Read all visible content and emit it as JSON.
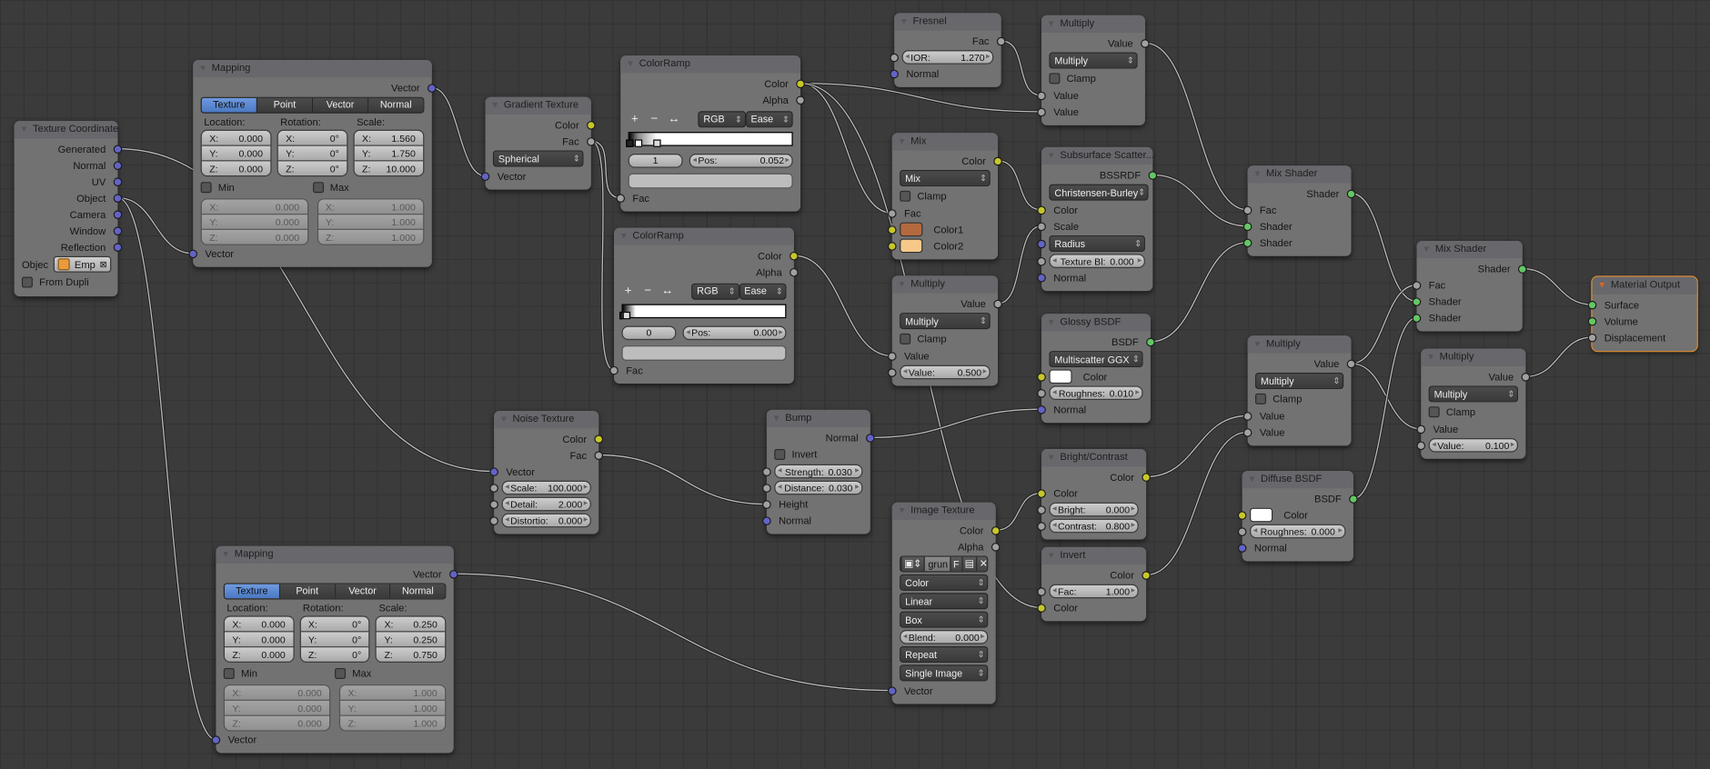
{
  "socket_colors": {
    "shader": "#63c763",
    "color": "#c7c729",
    "value": "#a1a1a1",
    "vector": "#6363c7"
  },
  "active_outline_color": "#e8912e",
  "nodes": [
    {
      "id": "texcoord",
      "title": "Texture Coordinate",
      "rows": [
        {
          "t": "out",
          "label": "Generated",
          "s": "vector"
        },
        {
          "t": "out",
          "label": "Normal",
          "s": "vector"
        },
        {
          "t": "out",
          "label": "UV",
          "s": "vector"
        },
        {
          "t": "out",
          "label": "Object",
          "s": "vector"
        },
        {
          "t": "out",
          "label": "Camera",
          "s": "vector"
        },
        {
          "t": "out",
          "label": "Window",
          "s": "vector"
        },
        {
          "t": "out",
          "label": "Reflection",
          "s": "vector"
        },
        {
          "t": "obj",
          "label": "Objec",
          "value": "Emp",
          "icon": "cube-icon"
        },
        {
          "t": "check",
          "label": "From Dupli"
        }
      ]
    },
    {
      "id": "mapping1",
      "title": "Mapping",
      "rows": [
        {
          "t": "out",
          "label": "Vector",
          "s": "vector"
        },
        {
          "t": "tabs",
          "items": [
            "Texture",
            "Point",
            "Vector",
            "Normal"
          ],
          "active": 0
        },
        {
          "t": "mapgrid",
          "labels": [
            "Location:",
            "Rotation:",
            "Scale:"
          ],
          "cols": [
            [
              [
                "X:",
                "0.000"
              ],
              [
                "Y:",
                "0.000"
              ],
              [
                "Z:",
                "0.000"
              ]
            ],
            [
              [
                "X:",
                "0°"
              ],
              [
                "Y:",
                "0°"
              ],
              [
                "Z:",
                "0°"
              ]
            ],
            [
              [
                "X:",
                "1.560"
              ],
              [
                "Y:",
                "1.750"
              ],
              [
                "Z:",
                "10.000"
              ]
            ]
          ]
        },
        {
          "t": "minmax",
          "min_label": "Min",
          "max_label": "Max",
          "min": [
            [
              "X:",
              "0.000"
            ],
            [
              "Y:",
              "0.000"
            ],
            [
              "Z:",
              "0.000"
            ]
          ],
          "max": [
            [
              "X:",
              "1.000"
            ],
            [
              "Y:",
              "1.000"
            ],
            [
              "Z:",
              "1.000"
            ]
          ]
        },
        {
          "t": "in",
          "label": "Vector",
          "s": "vector"
        }
      ]
    },
    {
      "id": "gradient",
      "title": "Gradient Texture",
      "rows": [
        {
          "t": "out",
          "label": "Color",
          "s": "color"
        },
        {
          "t": "out",
          "label": "Fac",
          "s": "value"
        },
        {
          "t": "select",
          "value": "Spherical"
        },
        {
          "t": "in",
          "label": "Vector",
          "s": "vector"
        }
      ]
    },
    {
      "id": "colorramp1",
      "title": "ColorRamp",
      "rows": [
        {
          "t": "out",
          "label": "Color",
          "s": "color"
        },
        {
          "t": "out",
          "label": "Alpha",
          "s": "value"
        },
        {
          "t": "tools",
          "add": "+",
          "remove": "−",
          "flip": "↔",
          "mode": "RGB",
          "interp": "Ease"
        },
        {
          "t": "ramp",
          "stops": [
            0,
            0.052,
            0.17
          ],
          "active": 1
        },
        {
          "t": "rampsel",
          "index": "1",
          "pos_label": "Pos:",
          "pos": "0.052"
        },
        {
          "t": "colorbar",
          "color": "#bdbdbd"
        },
        {
          "t": "in",
          "label": "Fac",
          "s": "value"
        }
      ]
    },
    {
      "id": "colorramp2",
      "title": "ColorRamp",
      "rows": [
        {
          "t": "out",
          "label": "Color",
          "s": "color"
        },
        {
          "t": "out",
          "label": "Alpha",
          "s": "value"
        },
        {
          "t": "tools",
          "add": "+",
          "remove": "−",
          "flip": "↔",
          "mode": "RGB",
          "interp": "Ease"
        },
        {
          "t": "ramp",
          "stops": [
            0,
            0.02
          ],
          "active": 0
        },
        {
          "t": "rampsel",
          "index": "0",
          "pos_label": "Pos:",
          "pos": "0.000"
        },
        {
          "t": "colorbar",
          "color": "#bdbdbd"
        },
        {
          "t": "in",
          "label": "Fac",
          "s": "value"
        }
      ]
    },
    {
      "id": "fresnel",
      "title": "Fresnel",
      "rows": [
        {
          "t": "out",
          "label": "Fac",
          "s": "value"
        },
        {
          "t": "field",
          "label": "IOR:",
          "value": "1.270",
          "s": "value"
        },
        {
          "t": "in",
          "label": "Normal",
          "s": "vector"
        }
      ]
    },
    {
      "id": "multiply1",
      "title": "Multiply",
      "rows": [
        {
          "t": "out",
          "label": "Value",
          "s": "value"
        },
        {
          "t": "select",
          "value": "Multiply"
        },
        {
          "t": "check",
          "label": "Clamp"
        },
        {
          "t": "in",
          "label": "Value",
          "s": "value"
        },
        {
          "t": "in",
          "label": "Value",
          "s": "value"
        }
      ]
    },
    {
      "id": "mix",
      "title": "Mix",
      "rows": [
        {
          "t": "out",
          "label": "Color",
          "s": "color"
        },
        {
          "t": "select",
          "value": "Mix"
        },
        {
          "t": "check",
          "label": "Clamp"
        },
        {
          "t": "in",
          "label": "Fac",
          "s": "value"
        },
        {
          "t": "swatch",
          "label": "Color1",
          "color": "#b5693f",
          "s": "color"
        },
        {
          "t": "swatch",
          "label": "Color2",
          "color": "#f6c98a",
          "s": "color"
        }
      ]
    },
    {
      "id": "sss",
      "title": "Subsurface Scatter...",
      "rows": [
        {
          "t": "out",
          "label": "BSSRDF",
          "s": "shader"
        },
        {
          "t": "select",
          "value": "Christensen-Burley"
        },
        {
          "t": "in",
          "label": "Color",
          "s": "color"
        },
        {
          "t": "in",
          "label": "Scale",
          "s": "value"
        },
        {
          "t": "select",
          "value": "Radius",
          "s": "vector"
        },
        {
          "t": "field",
          "label": "Texture Bl:",
          "value": "0.000",
          "s": "value",
          "center": true
        },
        {
          "t": "in",
          "label": "Normal",
          "s": "vector"
        }
      ]
    },
    {
      "id": "multiply2",
      "title": "Multiply",
      "rows": [
        {
          "t": "out",
          "label": "Value",
          "s": "value"
        },
        {
          "t": "select",
          "value": "Multiply"
        },
        {
          "t": "check",
          "label": "Clamp"
        },
        {
          "t": "in",
          "label": "Value",
          "s": "value"
        },
        {
          "t": "field",
          "label": "Value:",
          "value": "0.500",
          "s": "value"
        }
      ]
    },
    {
      "id": "glossy",
      "title": "Glossy BSDF",
      "rows": [
        {
          "t": "out",
          "label": "BSDF",
          "s": "shader"
        },
        {
          "t": "select",
          "value": "Multiscatter GGX"
        },
        {
          "t": "swatch",
          "label": "Color",
          "color": "#ffffff",
          "s": "color"
        },
        {
          "t": "field",
          "label": "Roughnes:",
          "value": "0.010",
          "s": "value",
          "center": true
        },
        {
          "t": "in",
          "label": "Normal",
          "s": "vector"
        }
      ]
    },
    {
      "id": "mixshader1",
      "title": "Mix Shader",
      "rows": [
        {
          "t": "out",
          "label": "Shader",
          "s": "shader"
        },
        {
          "t": "in",
          "label": "Fac",
          "s": "value"
        },
        {
          "t": "in",
          "label": "Shader",
          "s": "shader"
        },
        {
          "t": "in",
          "label": "Shader",
          "s": "shader"
        }
      ]
    },
    {
      "id": "mixshader2",
      "title": "Mix Shader",
      "rows": [
        {
          "t": "out",
          "label": "Shader",
          "s": "shader"
        },
        {
          "t": "in",
          "label": "Fac",
          "s": "value"
        },
        {
          "t": "in",
          "label": "Shader",
          "s": "shader"
        },
        {
          "t": "in",
          "label": "Shader",
          "s": "shader"
        }
      ]
    },
    {
      "id": "matout",
      "title": "Material Output",
      "active": true,
      "rows": [
        {
          "t": "in",
          "label": "Surface",
          "s": "shader"
        },
        {
          "t": "in",
          "label": "Volume",
          "s": "shader"
        },
        {
          "t": "in",
          "label": "Displacement",
          "s": "value"
        }
      ]
    },
    {
      "id": "multiply3",
      "title": "Multiply",
      "rows": [
        {
          "t": "out",
          "label": "Value",
          "s": "value"
        },
        {
          "t": "select",
          "value": "Multiply"
        },
        {
          "t": "check",
          "label": "Clamp"
        },
        {
          "t": "in",
          "label": "Value",
          "s": "value"
        },
        {
          "t": "in",
          "label": "Value",
          "s": "value"
        }
      ]
    },
    {
      "id": "multiply4",
      "title": "Multiply",
      "rows": [
        {
          "t": "out",
          "label": "Value",
          "s": "value"
        },
        {
          "t": "select",
          "value": "Multiply"
        },
        {
          "t": "check",
          "label": "Clamp"
        },
        {
          "t": "in",
          "label": "Value",
          "s": "value"
        },
        {
          "t": "field",
          "label": "Value:",
          "value": "0.100",
          "s": "value"
        }
      ]
    },
    {
      "id": "noise",
      "title": "Noise Texture",
      "rows": [
        {
          "t": "out",
          "label": "Color",
          "s": "color"
        },
        {
          "t": "out",
          "label": "Fac",
          "s": "value"
        },
        {
          "t": "in",
          "label": "Vector",
          "s": "vector"
        },
        {
          "t": "field",
          "label": "Scale:",
          "value": "100.000",
          "s": "value"
        },
        {
          "t": "field",
          "label": "Detail:",
          "value": "2.000",
          "s": "value"
        },
        {
          "t": "field",
          "label": "Distortio:",
          "value": "0.000",
          "s": "value"
        }
      ]
    },
    {
      "id": "bump",
      "title": "Bump",
      "rows": [
        {
          "t": "out",
          "label": "Normal",
          "s": "vector"
        },
        {
          "t": "check",
          "label": "Invert"
        },
        {
          "t": "field",
          "label": "Strength:",
          "value": "0.030",
          "s": "value",
          "center": true
        },
        {
          "t": "field",
          "label": "Distance:",
          "value": "0.030",
          "s": "value",
          "center": true
        },
        {
          "t": "in",
          "label": "Height",
          "s": "value"
        },
        {
          "t": "in",
          "label": "Normal",
          "s": "vector"
        }
      ]
    },
    {
      "id": "imagetex",
      "title": "Image Texture",
      "rows": [
        {
          "t": "out",
          "label": "Color",
          "s": "color"
        },
        {
          "t": "out",
          "label": "Alpha",
          "s": "value"
        },
        {
          "t": "img",
          "name": "grun",
          "flag": "F"
        },
        {
          "t": "select",
          "value": "Color"
        },
        {
          "t": "select",
          "value": "Linear"
        },
        {
          "t": "select",
          "value": "Box"
        },
        {
          "t": "field",
          "label": "Blend:",
          "value": "0.000"
        },
        {
          "t": "select",
          "value": "Repeat"
        },
        {
          "t": "select",
          "value": "Single Image"
        },
        {
          "t": "in",
          "label": "Vector",
          "s": "vector"
        }
      ]
    },
    {
      "id": "bright",
      "title": "Bright/Contrast",
      "rows": [
        {
          "t": "out",
          "label": "Color",
          "s": "color"
        },
        {
          "t": "in",
          "label": "Color",
          "s": "color"
        },
        {
          "t": "field",
          "label": "Bright:",
          "value": "0.000",
          "s": "value"
        },
        {
          "t": "field",
          "label": "Contrast:",
          "value": "0.800",
          "s": "value"
        }
      ]
    },
    {
      "id": "invert",
      "title": "Invert",
      "rows": [
        {
          "t": "out",
          "label": "Color",
          "s": "color"
        },
        {
          "t": "field",
          "label": "Fac:",
          "value": "1.000",
          "s": "value"
        },
        {
          "t": "in",
          "label": "Color",
          "s": "color"
        }
      ]
    },
    {
      "id": "diffuse",
      "title": "Diffuse BSDF",
      "rows": [
        {
          "t": "out",
          "label": "BSDF",
          "s": "shader"
        },
        {
          "t": "swatch",
          "label": "Color",
          "color": "#ffffff",
          "s": "color"
        },
        {
          "t": "field",
          "label": "Roughnes:",
          "value": "0.000",
          "s": "value",
          "center": true
        },
        {
          "t": "in",
          "label": "Normal",
          "s": "vector"
        }
      ]
    },
    {
      "id": "mapping2",
      "title": "Mapping",
      "rows": [
        {
          "t": "out",
          "label": "Vector",
          "s": "vector"
        },
        {
          "t": "tabs",
          "items": [
            "Texture",
            "Point",
            "Vector",
            "Normal"
          ],
          "active": 0
        },
        {
          "t": "mapgrid",
          "labels": [
            "Location:",
            "Rotation:",
            "Scale:"
          ],
          "cols": [
            [
              [
                "X:",
                "0.000"
              ],
              [
                "Y:",
                "0.000"
              ],
              [
                "Z:",
                "0.000"
              ]
            ],
            [
              [
                "X:",
                "0°"
              ],
              [
                "Y:",
                "0°"
              ],
              [
                "Z:",
                "0°"
              ]
            ],
            [
              [
                "X:",
                "0.250"
              ],
              [
                "Y:",
                "0.250"
              ],
              [
                "Z:",
                "0.750"
              ]
            ]
          ]
        },
        {
          "t": "minmax",
          "min_label": "Min",
          "max_label": "Max",
          "min": [
            [
              "X:",
              "0.000"
            ],
            [
              "Y:",
              "0.000"
            ],
            [
              "Z:",
              "0.000"
            ]
          ],
          "max": [
            [
              "X:",
              "1.000"
            ],
            [
              "Y:",
              "1.000"
            ],
            [
              "Z:",
              "1.000"
            ]
          ]
        },
        {
          "t": "in",
          "label": "Vector",
          "s": "vector"
        }
      ]
    }
  ],
  "links": [
    [
      "texcoord",
      0,
      "noise",
      0
    ],
    [
      "texcoord",
      3,
      "mapping1",
      0
    ],
    [
      "texcoord",
      3,
      "mapping2",
      0
    ],
    [
      "mapping1",
      0,
      "gradient",
      0
    ],
    [
      "gradient",
      1,
      "colorramp1",
      0
    ],
    [
      "gradient",
      1,
      "colorramp2",
      0
    ],
    [
      "colorramp1",
      0,
      "multiply1",
      1
    ],
    [
      "colorramp1",
      0,
      "mix",
      0
    ],
    [
      "colorramp1",
      0,
      "invert",
      1
    ],
    [
      "colorramp2",
      0,
      "multiply2",
      0
    ],
    [
      "fresnel",
      0,
      "multiply1",
      0
    ],
    [
      "multiply1",
      0,
      "mixshader1",
      0
    ],
    [
      "mix",
      0,
      "sss",
      0
    ],
    [
      "multiply2",
      0,
      "sss",
      1
    ],
    [
      "sss",
      0,
      "mixshader1",
      1
    ],
    [
      "glossy",
      0,
      "mixshader1",
      2
    ],
    [
      "bump",
      0,
      "glossy",
      2
    ],
    [
      "noise",
      1,
      "bump",
      2
    ],
    [
      "mapping2",
      0,
      "imagetex",
      0
    ],
    [
      "imagetex",
      0,
      "bright",
      0
    ],
    [
      "bright",
      0,
      "multiply3",
      0
    ],
    [
      "invert",
      0,
      "multiply3",
      1
    ],
    [
      "mixshader1",
      0,
      "mixshader2",
      1
    ],
    [
      "multiply3",
      0,
      "mixshader2",
      0
    ],
    [
      "multiply3",
      0,
      "multiply4",
      0
    ],
    [
      "diffuse",
      0,
      "mixshader2",
      2
    ],
    [
      "mixshader2",
      0,
      "matout",
      0
    ],
    [
      "multiply4",
      0,
      "matout",
      2
    ]
  ]
}
